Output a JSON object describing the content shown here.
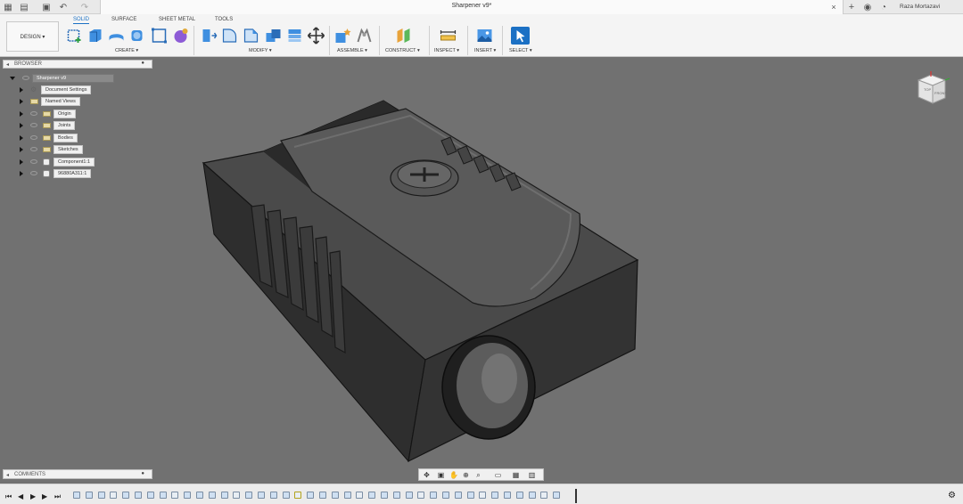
{
  "window": {
    "doc_title": "Sharpener v9*",
    "user_name": "Raza Mortazavi"
  },
  "ribbon": {
    "workspace_label": "DESIGN ▾",
    "tabs": [
      {
        "label": "SOLID",
        "active": true
      },
      {
        "label": "SURFACE",
        "active": false
      },
      {
        "label": "SHEET METAL",
        "active": false
      },
      {
        "label": "TOOLS",
        "active": false
      }
    ],
    "groups": {
      "create": "CREATE ▾",
      "modify": "MODIFY ▾",
      "assemble": "ASSEMBLE ▾",
      "construct": "CONSTRUCT ▾",
      "inspect": "INSPECT ▾",
      "insert": "INSERT ▾",
      "select": "SELECT ▾"
    }
  },
  "browser": {
    "title": "BROWSER",
    "items": [
      {
        "label": "Sharpener v9",
        "icon": "component-icon"
      },
      {
        "label": "Document Settings",
        "icon": "gear-icon"
      },
      {
        "label": "Named Views",
        "icon": "folder-icon"
      },
      {
        "label": "Origin",
        "icon": "folder-icon"
      },
      {
        "label": "Joints",
        "icon": "folder-icon"
      },
      {
        "label": "Bodies",
        "icon": "folder-icon"
      },
      {
        "label": "Sketches",
        "icon": "folder-icon"
      },
      {
        "label": "Component1:1",
        "icon": "component-icon"
      },
      {
        "label": "96880A311:1",
        "icon": "component-icon"
      }
    ]
  },
  "comments": {
    "title": "COMMENTS"
  },
  "viewcube": {
    "top_label": "TOP",
    "front_label": "FRONT"
  },
  "colors": {
    "accent": "#1b70c4",
    "viewport_bg": "#717171",
    "model_body": "#3a3a3a"
  }
}
